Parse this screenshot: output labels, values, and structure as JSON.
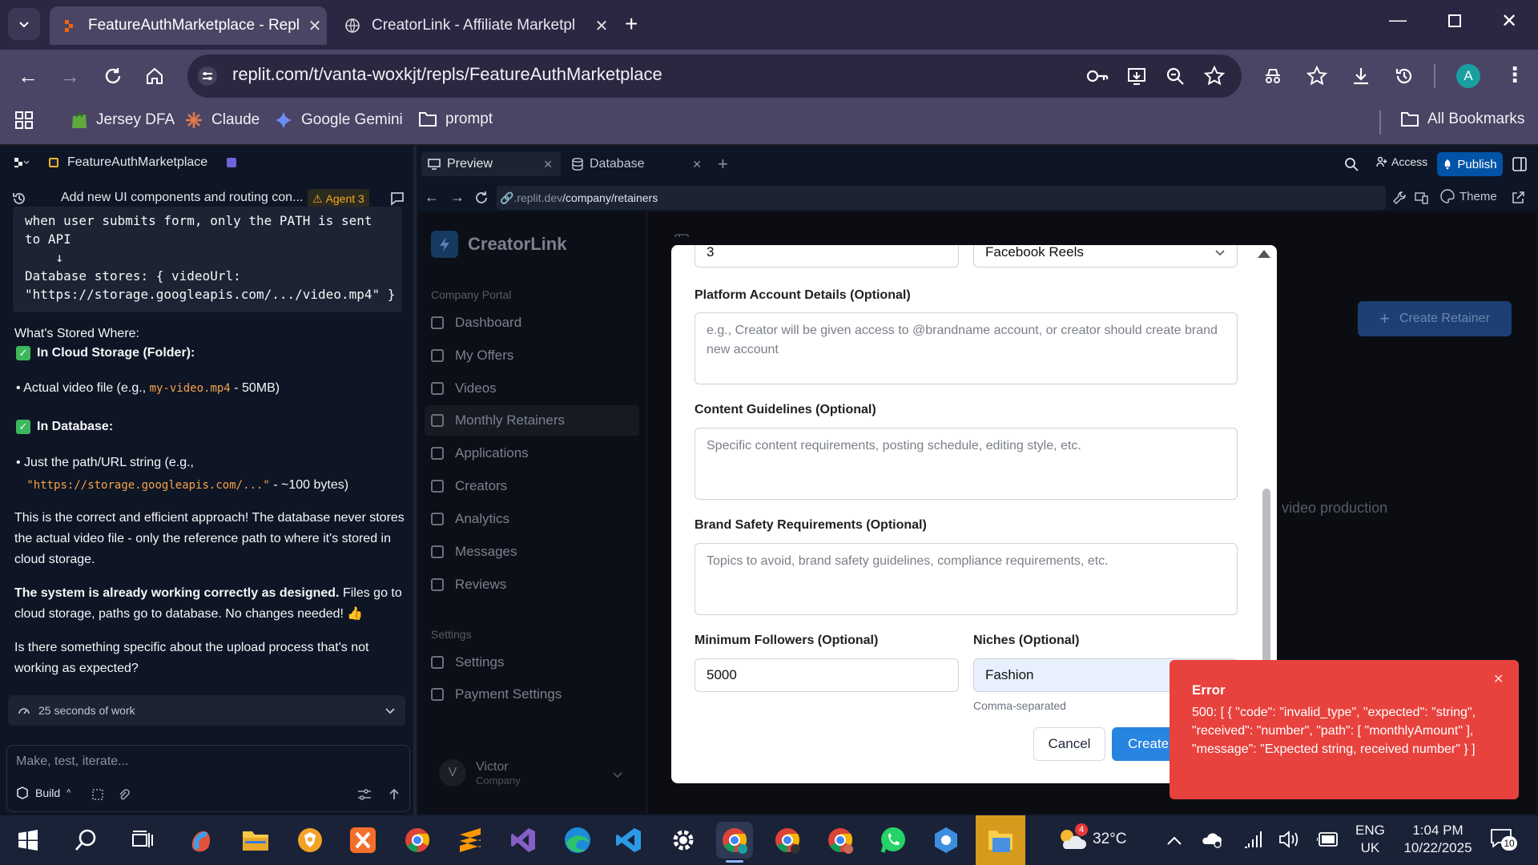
{
  "browser": {
    "tabs": [
      {
        "title": "FeatureAuthMarketplace - Repl"
      },
      {
        "title": "CreatorLink - Affiliate Marketpl"
      }
    ],
    "url": "replit.com/t/vanta-woxkjt/repls/FeatureAuthMarketplace",
    "bookmarks": [
      "Jersey DFA",
      "Claude",
      "Google Gemini",
      "prompt"
    ],
    "all_bookmarks": "All Bookmarks",
    "profile_initial": "A"
  },
  "replit": {
    "project_name": "FeatureAuthMarketplace",
    "chat_title": "Add new UI components and routing con...",
    "agent_badge": "Agent 3",
    "code_lines": [
      "when user submits form, only the PATH is sent",
      "to API",
      "    ↓",
      "Database stores: { videoUrl:",
      "\"https://storage.googleapis.com/.../video.mp4\" }"
    ],
    "whats_stored": "What's Stored Where:",
    "cloud_heading": "In Cloud Storage (Folder):",
    "cloud_bullet_a": "Actual video file (e.g., ",
    "cloud_bullet_code": "my-video.mp4",
    "cloud_bullet_b": " - 50MB)",
    "db_heading": "In Database:",
    "db_bullet_a": "Just the path/URL string (e.g.,",
    "db_bullet_code": "\"https://storage.googleapis.com/...\"",
    "db_bullet_b": " - ~100 bytes)",
    "para1": "This is the correct and efficient approach! The database never stores the actual video file - only the reference path to where it's stored in cloud storage.",
    "para2_bold": "The system is already working correctly as designed.",
    "para2_rest": " Files go to cloud storage, paths go to database. No changes needed! 👍",
    "para3": "Is there something specific about the upload process that's not working as expected?",
    "work_label": "25 seconds of work",
    "prompt_placeholder": "Make, test, iterate...",
    "build_label": "Build",
    "tabs": [
      "Preview",
      "Database"
    ],
    "access_label": "Access",
    "publish_label": "Publish",
    "preview_url_host": ".replit.dev",
    "preview_url_path": "/company/retainers",
    "theme_label": "Theme"
  },
  "app": {
    "brand": "CreatorLink",
    "section_portal": "Company Portal",
    "nav": [
      "Dashboard",
      "My Offers",
      "Videos",
      "Monthly Retainers",
      "Applications",
      "Creators",
      "Analytics",
      "Messages",
      "Reviews"
    ],
    "section_settings": "Settings",
    "settings_nav": [
      "Settings",
      "Payment Settings"
    ],
    "user_initial": "V",
    "user_name": "Victor",
    "user_role": "Company",
    "create_retainer": "Create Retainer",
    "bg_text": "video production"
  },
  "modal": {
    "top_number_value": "3",
    "platform_select": "Facebook Reels",
    "platform_details_label": "Platform Account Details (Optional)",
    "platform_details_placeholder": "e.g., Creator will be given access to @brandname account, or creator should create brand new account",
    "content_label": "Content Guidelines (Optional)",
    "content_placeholder": "Specific content requirements, posting schedule, editing style, etc.",
    "safety_label": "Brand Safety Requirements (Optional)",
    "safety_placeholder": "Topics to avoid, brand safety guidelines, compliance requirements, etc.",
    "min_followers_label": "Minimum Followers (Optional)",
    "min_followers_value": "5000",
    "niches_label": "Niches (Optional)",
    "niches_value": "Fashion",
    "niches_hint": "Comma-separated",
    "cancel": "Cancel",
    "create": "Create"
  },
  "toast": {
    "title": "Error",
    "message": "500: [ { \"code\": \"invalid_type\", \"expected\": \"string\", \"received\": \"number\", \"path\": [ \"monthlyAmount\" ], \"message\": \"Expected string, received number\" } ]"
  },
  "taskbar": {
    "weather": "32°C",
    "weather_badge": "4",
    "lang1": "ENG",
    "lang2": "UK",
    "time": "1:04 PM",
    "date": "10/22/2025",
    "notif_count": "10"
  }
}
